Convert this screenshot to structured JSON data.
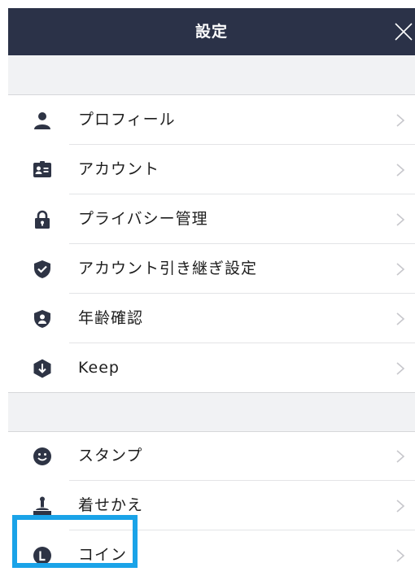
{
  "header": {
    "title": "設定",
    "close_icon": "close-icon"
  },
  "section1": {
    "items": [
      {
        "label": "プロフィール",
        "icon": "person-icon"
      },
      {
        "label": "アカウント",
        "icon": "id-card-icon"
      },
      {
        "label": "プライバシー管理",
        "icon": "lock-icon"
      },
      {
        "label": "アカウント引き継ぎ設定",
        "icon": "shield-check-icon"
      },
      {
        "label": "年齢確認",
        "icon": "shield-person-icon"
      },
      {
        "label": "Keep",
        "icon": "keep-download-icon"
      }
    ]
  },
  "section2": {
    "items": [
      {
        "label": "スタンプ",
        "icon": "smiley-icon"
      },
      {
        "label": "着せかえ",
        "icon": "brush-icon"
      },
      {
        "label": "コイン",
        "icon": "coin-icon"
      }
    ]
  },
  "colors": {
    "header_bg": "#2b3248",
    "icon": "#2e3445",
    "highlight": "#1aa3e8",
    "chevron": "#c7c7cc",
    "section_bg": "#f1f2f4"
  }
}
